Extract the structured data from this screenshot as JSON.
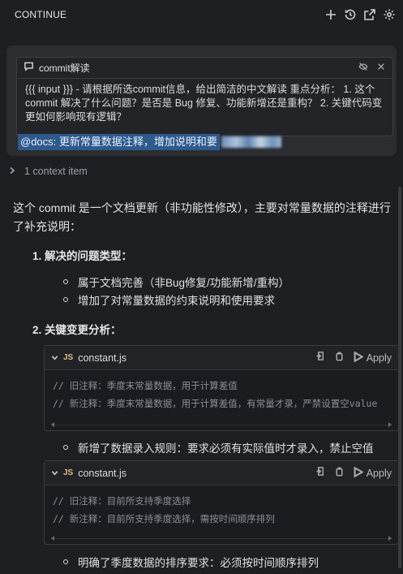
{
  "header": {
    "title": "CONTINUE",
    "icons": [
      "plus-icon",
      "history-icon",
      "open-external-icon",
      "gear-icon"
    ]
  },
  "prompt": {
    "name": "commit解读",
    "text": "{{{ input }}} - 请根据所选commit信息，给出简洁的中文解读 重点分析： 1. 这个commit 解决了什么问题？是否是 Bug 修复、功能新增还是重构？ 2. 关键代码变更如何影响现有逻辑？",
    "docs_text": "@docs: 更新常量数据注释，增加说明和要"
  },
  "context": {
    "label": "1 context item"
  },
  "answer": {
    "intro": "这个 commit 是一个文档更新（非功能性修改），主要对常量数据的注释进行了补充说明：",
    "section1": {
      "title": "1. 解决的问题类型：",
      "bullets": [
        "属于文档完善（非Bug修复/功能新增/重构）",
        "增加了对常量数据的约束说明和使用要求"
      ]
    },
    "section2": {
      "title": "2. 关键变更分析："
    },
    "code1": {
      "lang": "JS",
      "filename": "constant.js",
      "apply_label": "Apply",
      "lines": [
        "// 旧注释：季度末常量数据，用于计算差值",
        "// 新注释：季度末常量数据，用于计算差值，有常量才录，严禁设置空value"
      ]
    },
    "bullet3": "新增了数据录入规则：要求必须有实际值时才录入，禁止空值",
    "code2": {
      "lang": "JS",
      "filename": "constant.js",
      "apply_label": "Apply",
      "lines": [
        "// 旧注释：目前所支持季度选择",
        "// 新注释：目前所支持季度选择，需按时间顺序排列"
      ]
    },
    "bullet4": "明确了季度数据的排序要求：必须按时间顺序排列"
  }
}
